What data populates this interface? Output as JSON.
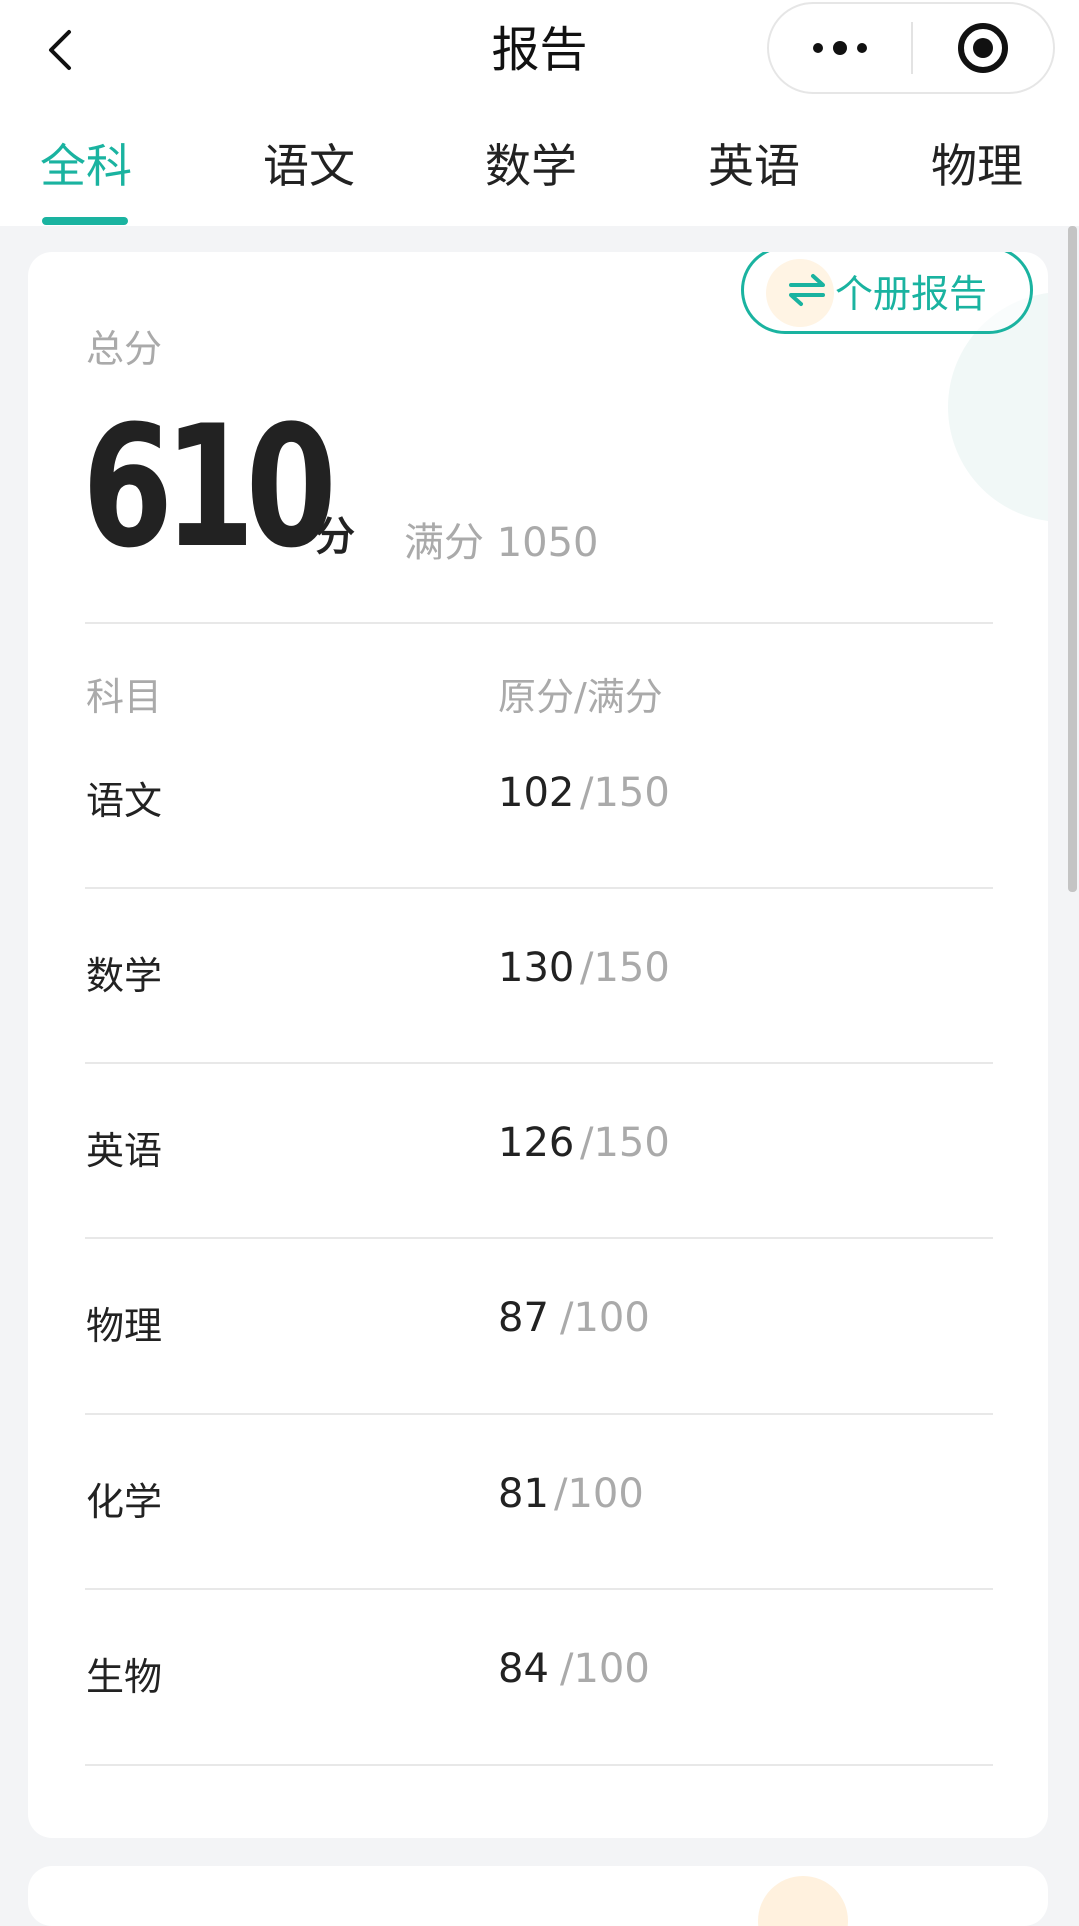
{
  "header": {
    "title": "报告"
  },
  "tabs": [
    {
      "label": "全科",
      "active": true
    },
    {
      "label": "语文",
      "active": false
    },
    {
      "label": "数学",
      "active": false
    },
    {
      "label": "英语",
      "active": false
    },
    {
      "label": "物理",
      "active": false
    }
  ],
  "summary": {
    "report_button_label": "个册报告",
    "total_label": "总分",
    "total_value": "610",
    "total_unit": "分",
    "full_label": "满分 1050"
  },
  "table": {
    "columns": [
      "科目",
      "原分/满分"
    ],
    "rows": [
      {
        "subject": "语文",
        "score": "102",
        "full": "/150"
      },
      {
        "subject": "数学",
        "score": "130",
        "full": "/150"
      },
      {
        "subject": "英语",
        "score": "126",
        "full": "/150"
      },
      {
        "subject": "物理",
        "score": "87",
        "full": "/100"
      },
      {
        "subject": "化学",
        "score": "81",
        "full": "/100"
      },
      {
        "subject": "生物",
        "score": "84",
        "full": "/100"
      }
    ]
  },
  "colors": {
    "accent": "#1ab3a0",
    "text": "#222222",
    "muted": "#aaaaaa",
    "background": "#f3f4f6"
  },
  "icons": [
    "back-chevron-icon",
    "more-dots-icon",
    "record-target-icon",
    "swap-arrows-icon"
  ]
}
